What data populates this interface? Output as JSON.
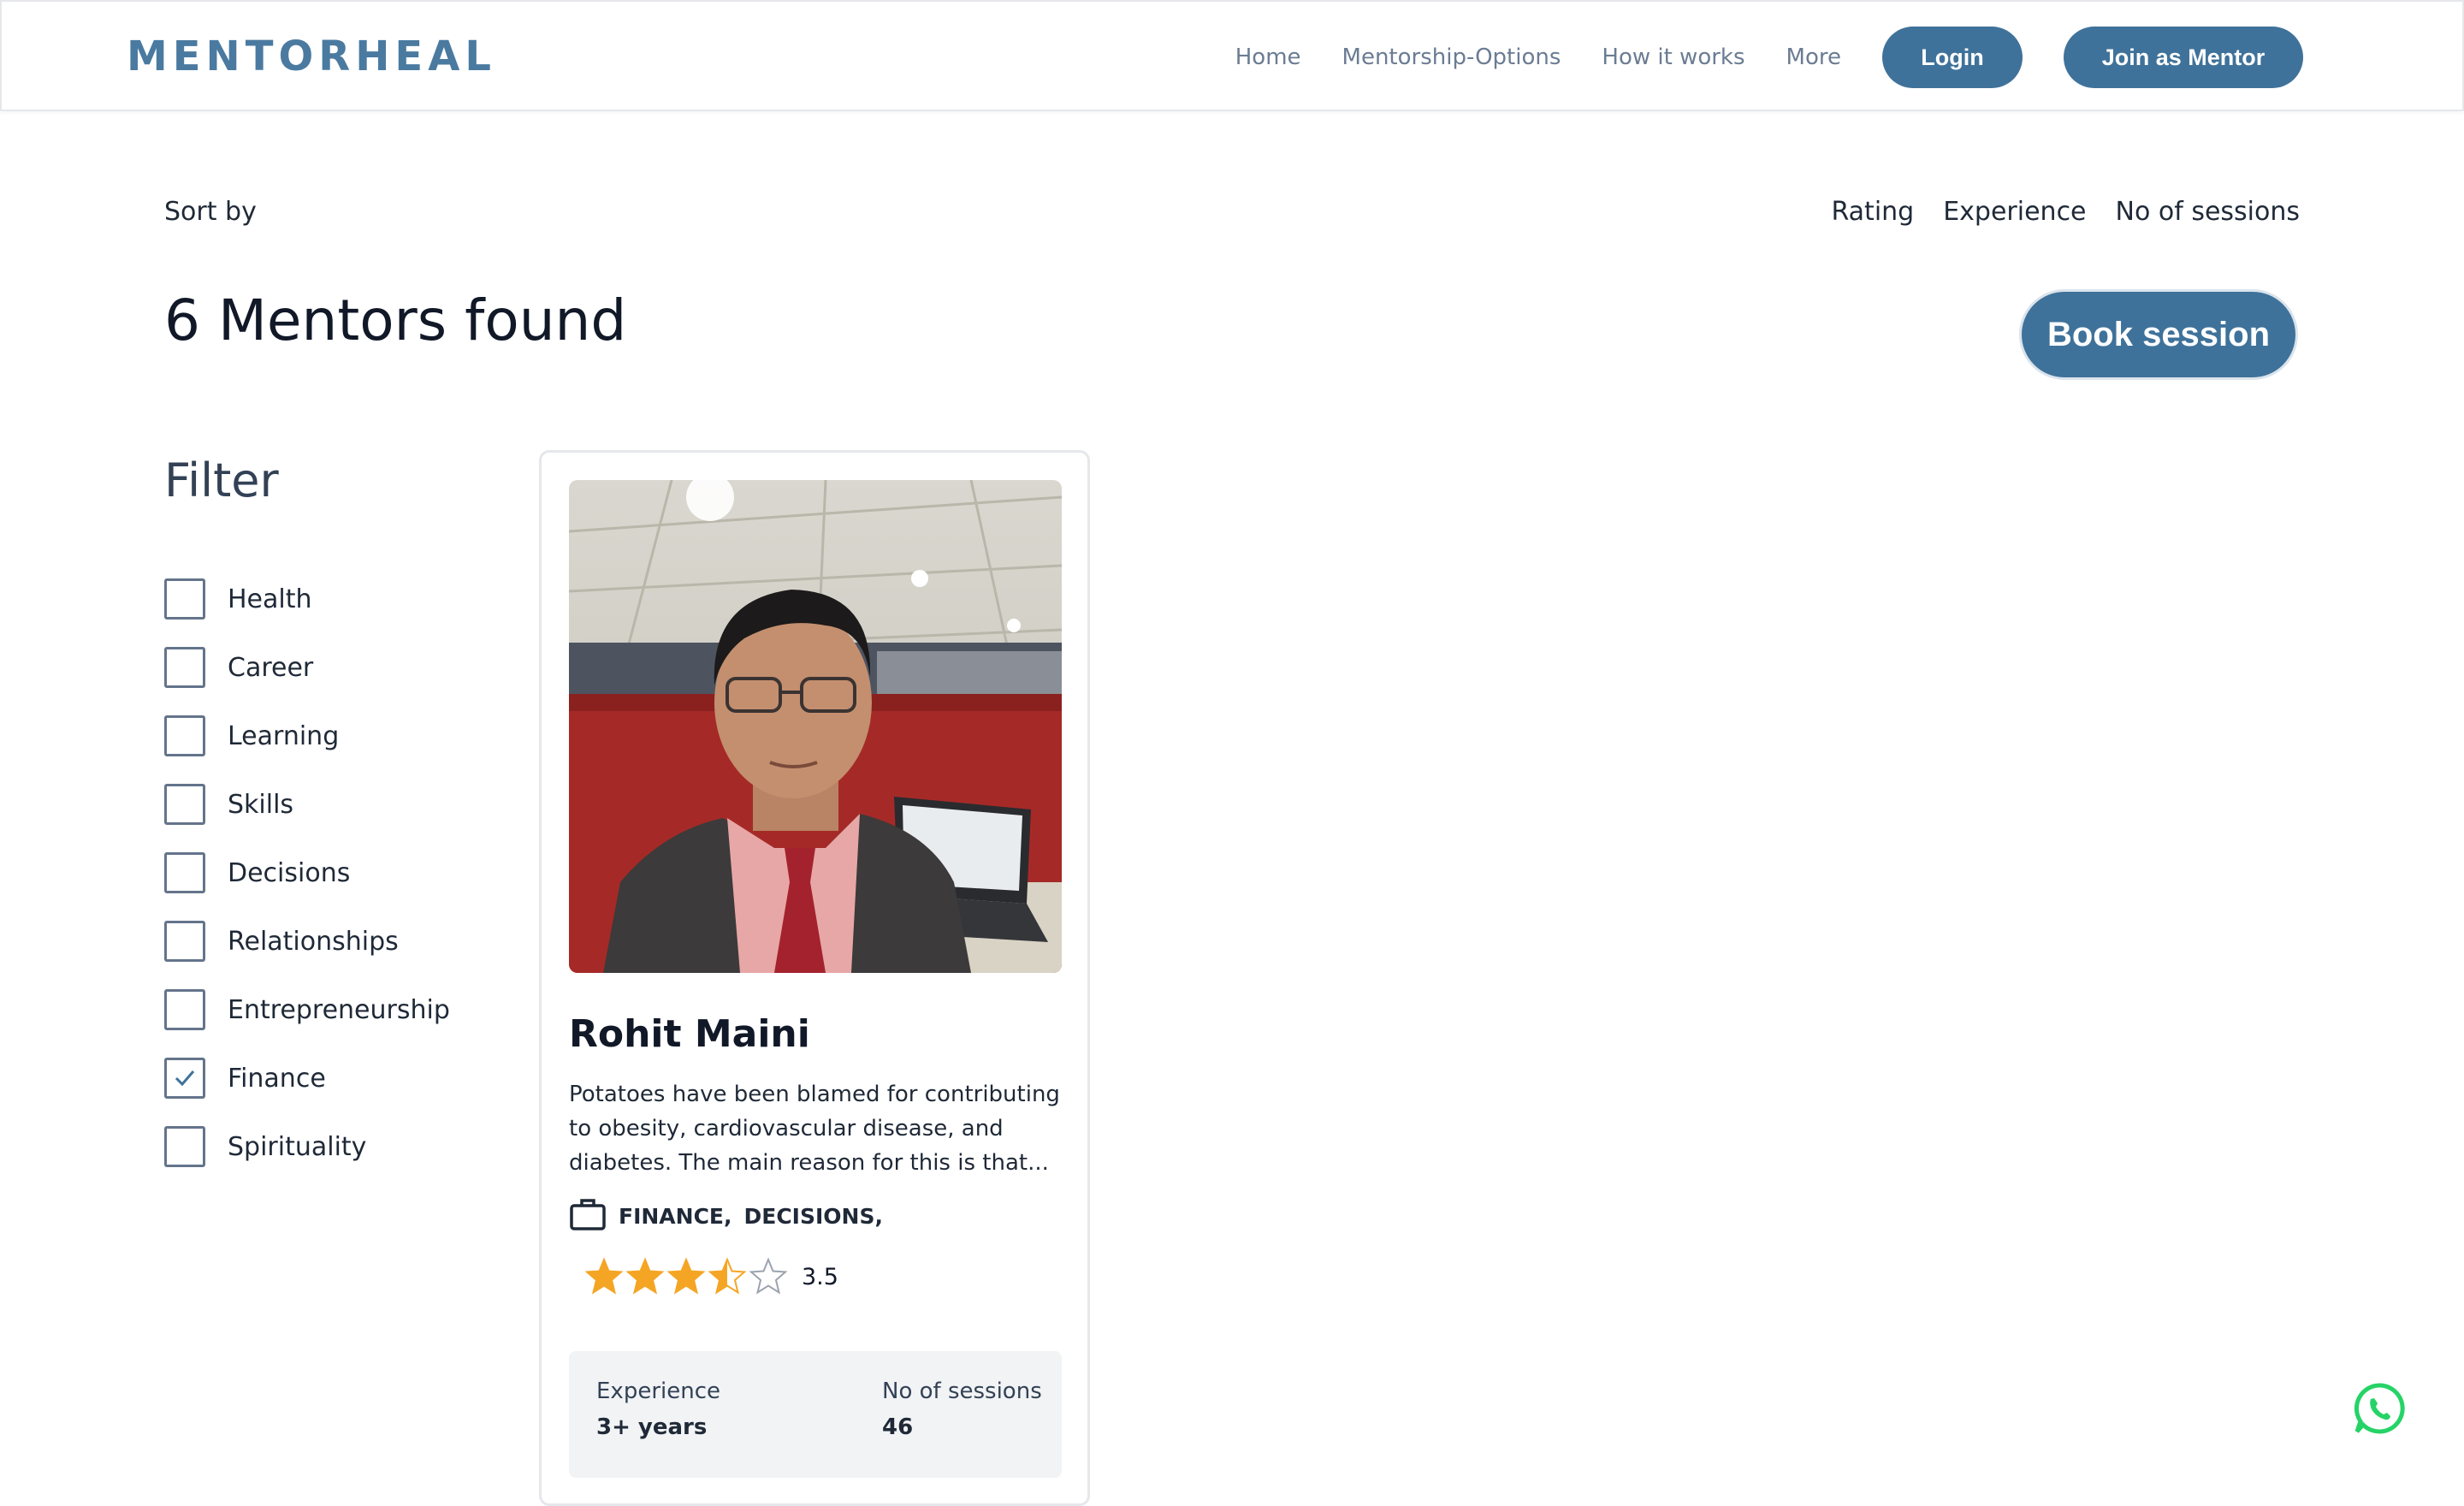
{
  "brand": {
    "logo": "MENTORHEAL",
    "accent": "#3f729a"
  },
  "nav": {
    "links": [
      "Home",
      "Mentorship-Options",
      "How it works",
      "More"
    ],
    "login": "Login",
    "join": "Join as Mentor"
  },
  "sort": {
    "label": "Sort by",
    "options": [
      "Rating",
      "Experience",
      "No of sessions"
    ]
  },
  "results_heading": "6 Mentors found",
  "book_session": "Book session",
  "filter": {
    "title": "Filter",
    "items": [
      {
        "label": "Health",
        "checked": false
      },
      {
        "label": "Career",
        "checked": false
      },
      {
        "label": "Learning",
        "checked": false
      },
      {
        "label": "Skills",
        "checked": false
      },
      {
        "label": "Decisions",
        "checked": false
      },
      {
        "label": "Relationships",
        "checked": false
      },
      {
        "label": "Entrepreneurship",
        "checked": false
      },
      {
        "label": "Finance",
        "checked": true
      },
      {
        "label": "Spirituality",
        "checked": false
      }
    ]
  },
  "mentor": {
    "name": "Rohit Maini",
    "bio_lines": [
      "Potatoes have been blamed for contributing",
      "to obesity, cardiovascular disease, and",
      "diabetes. The main reason for this is that..."
    ],
    "tags": [
      "FINANCE,",
      "DECISIONS,"
    ],
    "rating": 3.5,
    "rating_text": "3.5",
    "experience_label": "Experience",
    "experience_value": "3+ years",
    "sessions_label": "No of sessions",
    "sessions_value": "46"
  },
  "colors": {
    "star": "#f5a524",
    "whatsapp": "#25d366"
  },
  "icons": [
    "briefcase-icon",
    "star-icon",
    "checkmark-icon",
    "whatsapp-icon"
  ]
}
